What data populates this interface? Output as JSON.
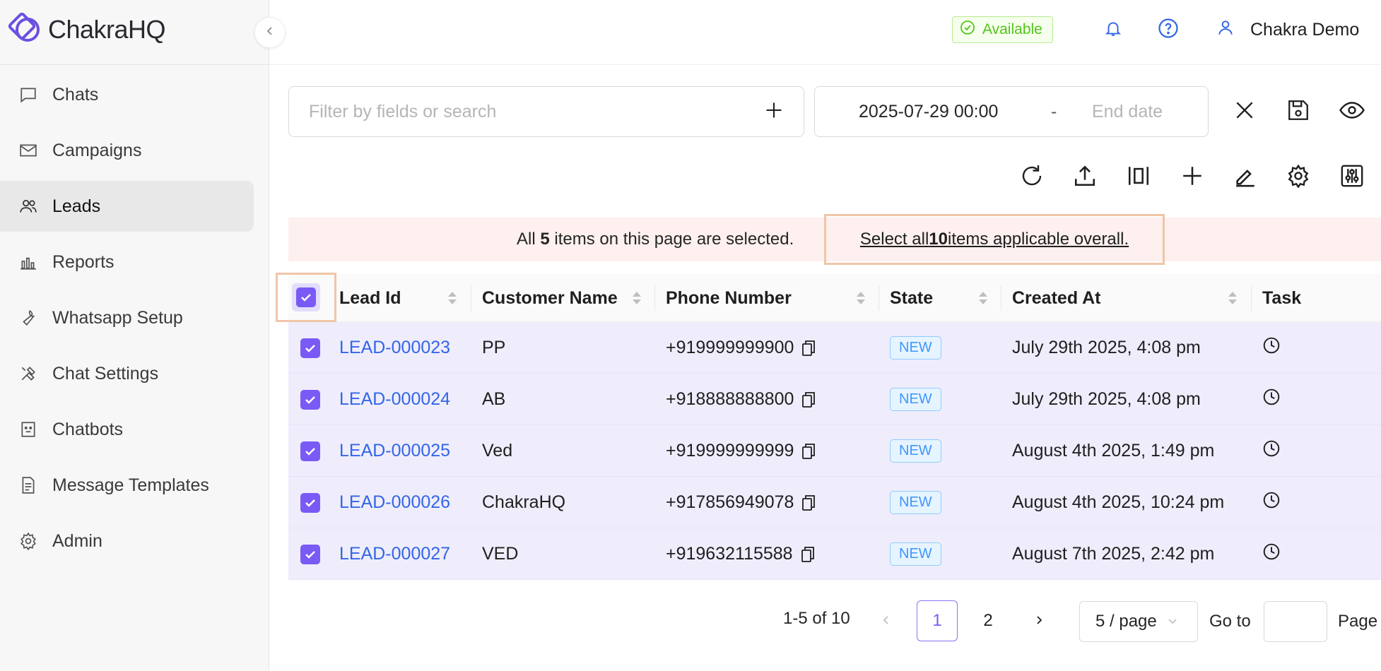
{
  "app": {
    "name": "ChakraHQ"
  },
  "sidebar": {
    "items": [
      {
        "label": "Chats",
        "icon": "chat-bubble-icon"
      },
      {
        "label": "Campaigns",
        "icon": "envelope-icon"
      },
      {
        "label": "Leads",
        "icon": "users-icon",
        "active": true
      },
      {
        "label": "Reports",
        "icon": "bar-chart-icon"
      },
      {
        "label": "Whatsapp Setup",
        "icon": "wrench-icon"
      },
      {
        "label": "Chat Settings",
        "icon": "tools-icon"
      },
      {
        "label": "Chatbots",
        "icon": "robot-icon"
      },
      {
        "label": "Message Templates",
        "icon": "document-icon"
      },
      {
        "label": "Admin",
        "icon": "gear-icon"
      }
    ]
  },
  "header": {
    "status": "Available",
    "user_name": "Chakra Demo"
  },
  "filter": {
    "placeholder": "Filter by fields or search",
    "start_date": "2025-07-29 00:00",
    "separator": "-",
    "end_placeholder": "End date"
  },
  "banner": {
    "prefix": "All ",
    "count": "5",
    "suffix": " items on this page are selected.",
    "select_all_prefix": "Select all ",
    "select_all_count": "10",
    "select_all_suffix": " items applicable overall."
  },
  "table": {
    "columns": [
      "Lead Id",
      "Customer Name",
      "Phone Number",
      "State",
      "Created At",
      "Task"
    ],
    "rows": [
      {
        "lead_id": "LEAD-000023",
        "name": "PP",
        "phone": "+919999999900",
        "state": "NEW",
        "created": "July 29th 2025, 4:08 pm"
      },
      {
        "lead_id": "LEAD-000024",
        "name": "AB",
        "phone": "+918888888800",
        "state": "NEW",
        "created": "July 29th 2025, 4:08 pm"
      },
      {
        "lead_id": "LEAD-000025",
        "name": "Ved",
        "phone": "+919999999999",
        "state": "NEW",
        "created": "August 4th 2025, 1:49 pm"
      },
      {
        "lead_id": "LEAD-000026",
        "name": "ChakraHQ",
        "phone": "+917856949078",
        "state": "NEW",
        "created": "August 4th 2025, 10:24 pm"
      },
      {
        "lead_id": "LEAD-000027",
        "name": "VED",
        "phone": "+919632115588",
        "state": "NEW",
        "created": "August 7th 2025, 2:42 pm"
      }
    ]
  },
  "pagination": {
    "total": "1-5 of 10",
    "pages": [
      "1",
      "2"
    ],
    "current": "1",
    "page_size": "5 / page",
    "goto_label": "Go to",
    "page_label": "Page"
  },
  "colors": {
    "accent": "#7a5af5",
    "link": "#3366e6",
    "row_selected": "#efedfc",
    "banner_bg": "#fdf0ee",
    "highlight_border": "#f0c5a8",
    "status_green": "#52c41a"
  }
}
